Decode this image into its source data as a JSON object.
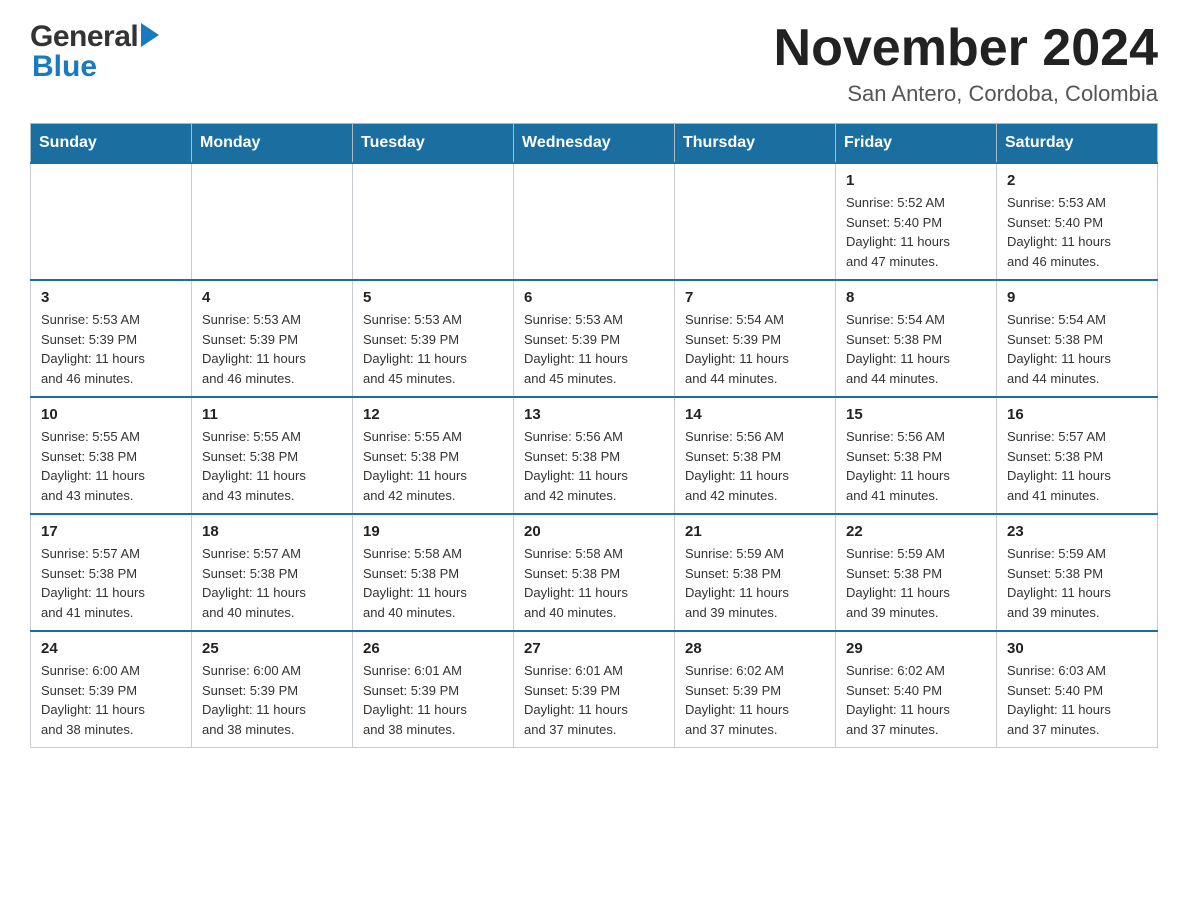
{
  "header": {
    "logo_general": "General",
    "logo_blue": "Blue",
    "month_title": "November 2024",
    "location": "San Antero, Cordoba, Colombia"
  },
  "days_of_week": [
    "Sunday",
    "Monday",
    "Tuesday",
    "Wednesday",
    "Thursday",
    "Friday",
    "Saturday"
  ],
  "weeks": [
    [
      {
        "day": "",
        "info": ""
      },
      {
        "day": "",
        "info": ""
      },
      {
        "day": "",
        "info": ""
      },
      {
        "day": "",
        "info": ""
      },
      {
        "day": "",
        "info": ""
      },
      {
        "day": "1",
        "info": "Sunrise: 5:52 AM\nSunset: 5:40 PM\nDaylight: 11 hours\nand 47 minutes."
      },
      {
        "day": "2",
        "info": "Sunrise: 5:53 AM\nSunset: 5:40 PM\nDaylight: 11 hours\nand 46 minutes."
      }
    ],
    [
      {
        "day": "3",
        "info": "Sunrise: 5:53 AM\nSunset: 5:39 PM\nDaylight: 11 hours\nand 46 minutes."
      },
      {
        "day": "4",
        "info": "Sunrise: 5:53 AM\nSunset: 5:39 PM\nDaylight: 11 hours\nand 46 minutes."
      },
      {
        "day": "5",
        "info": "Sunrise: 5:53 AM\nSunset: 5:39 PM\nDaylight: 11 hours\nand 45 minutes."
      },
      {
        "day": "6",
        "info": "Sunrise: 5:53 AM\nSunset: 5:39 PM\nDaylight: 11 hours\nand 45 minutes."
      },
      {
        "day": "7",
        "info": "Sunrise: 5:54 AM\nSunset: 5:39 PM\nDaylight: 11 hours\nand 44 minutes."
      },
      {
        "day": "8",
        "info": "Sunrise: 5:54 AM\nSunset: 5:38 PM\nDaylight: 11 hours\nand 44 minutes."
      },
      {
        "day": "9",
        "info": "Sunrise: 5:54 AM\nSunset: 5:38 PM\nDaylight: 11 hours\nand 44 minutes."
      }
    ],
    [
      {
        "day": "10",
        "info": "Sunrise: 5:55 AM\nSunset: 5:38 PM\nDaylight: 11 hours\nand 43 minutes."
      },
      {
        "day": "11",
        "info": "Sunrise: 5:55 AM\nSunset: 5:38 PM\nDaylight: 11 hours\nand 43 minutes."
      },
      {
        "day": "12",
        "info": "Sunrise: 5:55 AM\nSunset: 5:38 PM\nDaylight: 11 hours\nand 42 minutes."
      },
      {
        "day": "13",
        "info": "Sunrise: 5:56 AM\nSunset: 5:38 PM\nDaylight: 11 hours\nand 42 minutes."
      },
      {
        "day": "14",
        "info": "Sunrise: 5:56 AM\nSunset: 5:38 PM\nDaylight: 11 hours\nand 42 minutes."
      },
      {
        "day": "15",
        "info": "Sunrise: 5:56 AM\nSunset: 5:38 PM\nDaylight: 11 hours\nand 41 minutes."
      },
      {
        "day": "16",
        "info": "Sunrise: 5:57 AM\nSunset: 5:38 PM\nDaylight: 11 hours\nand 41 minutes."
      }
    ],
    [
      {
        "day": "17",
        "info": "Sunrise: 5:57 AM\nSunset: 5:38 PM\nDaylight: 11 hours\nand 41 minutes."
      },
      {
        "day": "18",
        "info": "Sunrise: 5:57 AM\nSunset: 5:38 PM\nDaylight: 11 hours\nand 40 minutes."
      },
      {
        "day": "19",
        "info": "Sunrise: 5:58 AM\nSunset: 5:38 PM\nDaylight: 11 hours\nand 40 minutes."
      },
      {
        "day": "20",
        "info": "Sunrise: 5:58 AM\nSunset: 5:38 PM\nDaylight: 11 hours\nand 40 minutes."
      },
      {
        "day": "21",
        "info": "Sunrise: 5:59 AM\nSunset: 5:38 PM\nDaylight: 11 hours\nand 39 minutes."
      },
      {
        "day": "22",
        "info": "Sunrise: 5:59 AM\nSunset: 5:38 PM\nDaylight: 11 hours\nand 39 minutes."
      },
      {
        "day": "23",
        "info": "Sunrise: 5:59 AM\nSunset: 5:38 PM\nDaylight: 11 hours\nand 39 minutes."
      }
    ],
    [
      {
        "day": "24",
        "info": "Sunrise: 6:00 AM\nSunset: 5:39 PM\nDaylight: 11 hours\nand 38 minutes."
      },
      {
        "day": "25",
        "info": "Sunrise: 6:00 AM\nSunset: 5:39 PM\nDaylight: 11 hours\nand 38 minutes."
      },
      {
        "day": "26",
        "info": "Sunrise: 6:01 AM\nSunset: 5:39 PM\nDaylight: 11 hours\nand 38 minutes."
      },
      {
        "day": "27",
        "info": "Sunrise: 6:01 AM\nSunset: 5:39 PM\nDaylight: 11 hours\nand 37 minutes."
      },
      {
        "day": "28",
        "info": "Sunrise: 6:02 AM\nSunset: 5:39 PM\nDaylight: 11 hours\nand 37 minutes."
      },
      {
        "day": "29",
        "info": "Sunrise: 6:02 AM\nSunset: 5:40 PM\nDaylight: 11 hours\nand 37 minutes."
      },
      {
        "day": "30",
        "info": "Sunrise: 6:03 AM\nSunset: 5:40 PM\nDaylight: 11 hours\nand 37 minutes."
      }
    ]
  ]
}
